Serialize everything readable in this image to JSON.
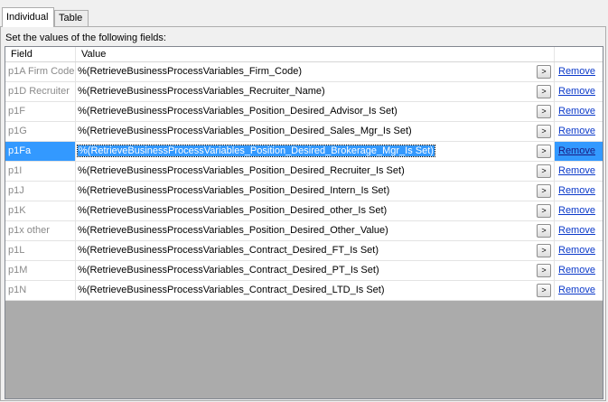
{
  "tabs": [
    {
      "label": "Individual",
      "active": true
    },
    {
      "label": "Table",
      "active": false
    }
  ],
  "instruction": "Set the values of the following fields:",
  "columns": {
    "field": "Field",
    "value": "Value"
  },
  "button_glyph": ">",
  "remove_label": "Remove",
  "selection_color": "#3399ff",
  "rows": [
    {
      "field": "p1A Firm Code",
      "value": "%(RetrieveBusinessProcessVariables_Firm_Code)"
    },
    {
      "field": "p1D Recruiter",
      "value": "%(RetrieveBusinessProcessVariables_Recruiter_Name)"
    },
    {
      "field": "p1F",
      "value": "%(RetrieveBusinessProcessVariables_Position_Desired_Advisor_Is Set)"
    },
    {
      "field": "p1G",
      "value": "%(RetrieveBusinessProcessVariables_Position_Desired_Sales_Mgr_Is Set)"
    },
    {
      "field": "p1Fa",
      "value": "%(RetrieveBusinessProcessVariables_Position_Desired_Brokerage_Mgr_Is Set)",
      "selected": true
    },
    {
      "field": "p1I",
      "value": "%(RetrieveBusinessProcessVariables_Position_Desired_Recruiter_Is Set)"
    },
    {
      "field": "p1J",
      "value": "%(RetrieveBusinessProcessVariables_Position_Desired_Intern_Is Set)"
    },
    {
      "field": "p1K",
      "value": "%(RetrieveBusinessProcessVariables_Position_Desired_other_Is Set)"
    },
    {
      "field": "p1x other",
      "value": "%(RetrieveBusinessProcessVariables_Position_Desired_Other_Value)"
    },
    {
      "field": "p1L",
      "value": "%(RetrieveBusinessProcessVariables_Contract_Desired_FT_Is Set)"
    },
    {
      "field": "p1M",
      "value": "%(RetrieveBusinessProcessVariables_Contract_Desired_PT_Is Set)"
    },
    {
      "field": "p1N",
      "value": "%(RetrieveBusinessProcessVariables_Contract_Desired_LTD_Is Set)"
    }
  ]
}
